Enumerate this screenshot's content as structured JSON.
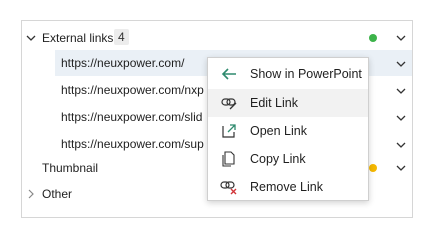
{
  "panel": {
    "external_links": {
      "label": "External links",
      "count": "4",
      "status_color": "#3cb34a"
    },
    "links": [
      {
        "url": "https://neuxpower.com/"
      },
      {
        "url": "https://neuxpower.com/nxp"
      },
      {
        "url": "https://neuxpower.com/slid"
      },
      {
        "url": "https://neuxpower.com/sup"
      }
    ],
    "thumbnail": {
      "label": "Thumbnail",
      "status_color": "#f5b800"
    },
    "other": {
      "label": "Other"
    }
  },
  "context_menu": {
    "items": [
      {
        "label": "Show in PowerPoint",
        "icon": "arrow-left-icon"
      },
      {
        "label": "Edit Link",
        "icon": "link-edit-icon"
      },
      {
        "label": "Open Link",
        "icon": "open-external-icon"
      },
      {
        "label": "Copy Link",
        "icon": "copy-icon"
      },
      {
        "label": "Remove Link",
        "icon": "link-remove-icon"
      }
    ],
    "accent_color": "#2f8a6e",
    "danger_color": "#d13438"
  }
}
